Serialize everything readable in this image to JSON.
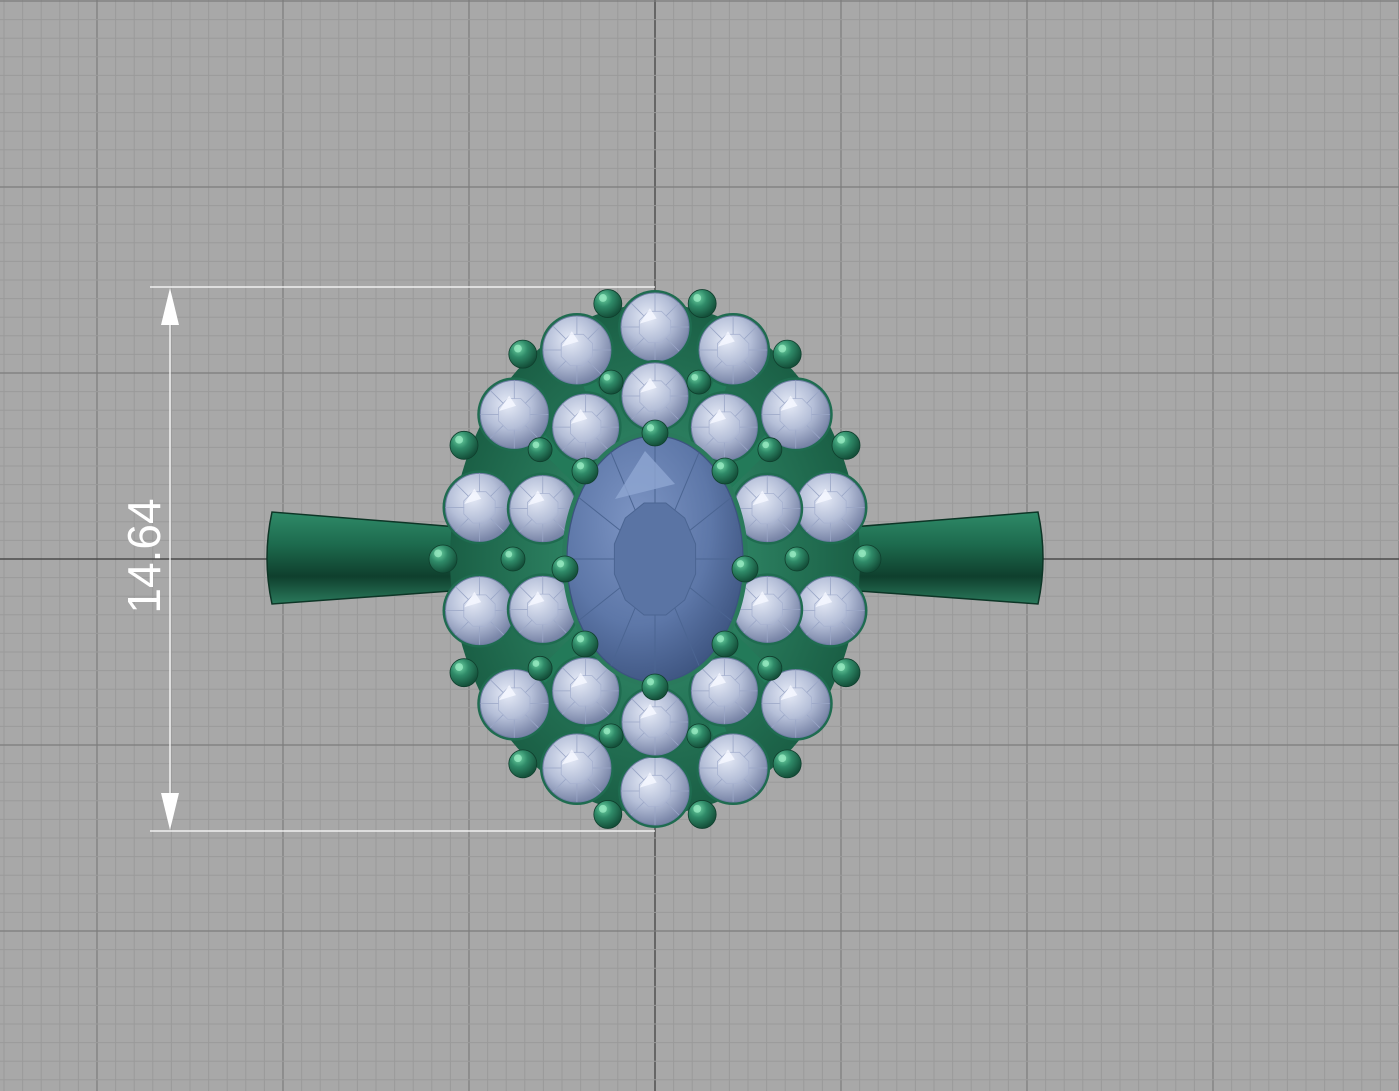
{
  "viewport": {
    "background_color": "#a8a8a8",
    "minor_grid_color": "#9a9a9a",
    "major_grid_color": "#7c7c7c",
    "axis_color": "#4a4a4a"
  },
  "dimension": {
    "value": "14.64",
    "color": "#ffffff"
  },
  "model": {
    "metal_color": "#2f8a68",
    "metal_dark": "#14503a",
    "stone_color": "#b5bfd8",
    "stone_dark": "#7a86a8",
    "center_stone_color": "#5d77a8",
    "center_stone_dark": "#3c537f"
  }
}
